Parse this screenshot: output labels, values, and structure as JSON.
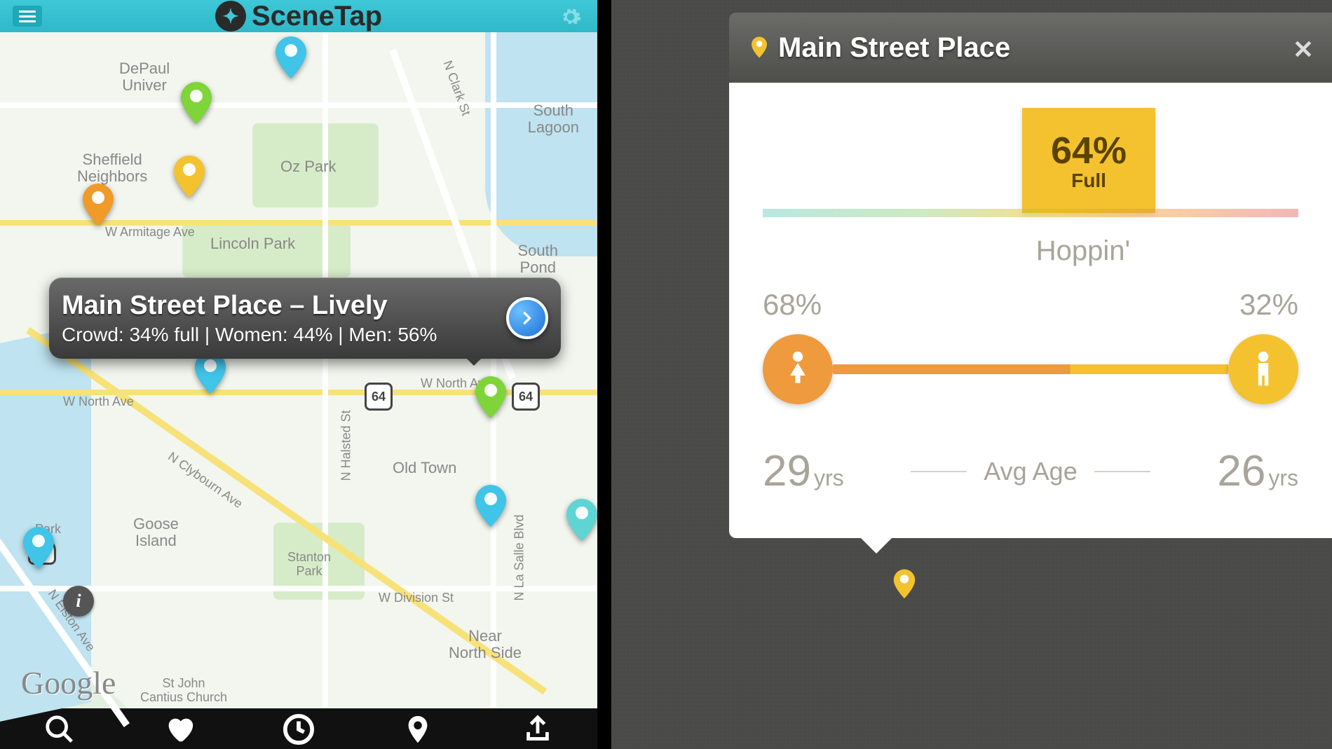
{
  "app": {
    "name": "SceneTap"
  },
  "map": {
    "labels": {
      "depaul": "DePaul\nUniver",
      "sheffield": "Sheffield\nNeighbors",
      "ozpark": "Oz Park",
      "lincolnpark": "Lincoln Park",
      "armitage": "W Armitage Ave",
      "southlagoon": "South\nLagoon",
      "southpond": "South\nPond",
      "northave": "W North Ave",
      "northave2": "W North Ave",
      "clybourn": "N Clybourn Ave",
      "halsted": "N Halsted St",
      "clark": "N Clark St",
      "lasalle": "N La Salle Blvd",
      "elston": "N Elston Ave",
      "oldtown": "Old Town",
      "goose": "Goose\nIsland",
      "stanton": "Stanton\nPark",
      "division": "W Division St",
      "near": "Near\nNorth Side",
      "stjohn": "St John\nCantius Church",
      "park": "Park",
      "shield64": "64"
    },
    "callout": {
      "title": "Main Street Place – Lively",
      "sub_prefix": "Crowd: ",
      "crowd_pct": "34%",
      "sub_mid1": " full | Women: ",
      "women_pct": "44%",
      "sub_mid2": " | Men: ",
      "men_pct": "56%"
    },
    "attribution": "Google"
  },
  "detail": {
    "title": "Main Street Place",
    "full_pct": "64%",
    "full_label": "Full",
    "status": "Hoppin'",
    "female_pct": "68%",
    "male_pct": "32%",
    "female_age": "29",
    "male_age": "26",
    "age_unit": "yrs",
    "avg_age_label": "Avg Age"
  },
  "colors": {
    "pin_green": "#7fd43a",
    "pin_yellow": "#f3c22e",
    "pin_orange": "#f09a2a",
    "pin_blue": "#40c4e8",
    "pin_cyan": "#5fd4d4"
  }
}
